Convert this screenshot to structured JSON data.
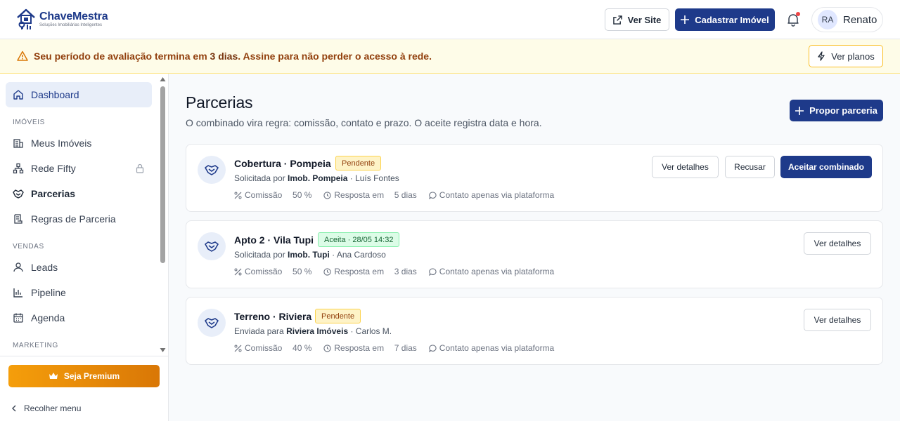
{
  "brand": {
    "name": "ChaveMestra",
    "tagline": "Soluções Imobiliárias Inteligentes"
  },
  "header": {
    "ver_site": "Ver Site",
    "cadastrar": "Cadastrar Imóvel",
    "user_initials": "RA",
    "user_name": "Renato"
  },
  "banner": {
    "text_before": "Seu período de avaliação termina em ",
    "highlight": "3 dias",
    "text_after": ". Assine para não perder o acesso à rede.",
    "button": "Ver planos"
  },
  "sidebar": {
    "dashboard": "Dashboard",
    "section_imoveis": "IMÓVEIS",
    "meus_imoveis": "Meus Imóveis",
    "rede_fifty": "Rede Fifty",
    "parcerias": "Parcerias",
    "regras": "Regras de Parceria",
    "section_vendas": "VENDAS",
    "leads": "Leads",
    "pipeline": "Pipeline",
    "agenda": "Agenda",
    "section_marketing": "MARKETING",
    "premium": "Seja Premium",
    "collapse": "Recolher menu"
  },
  "page": {
    "title": "Parcerias",
    "subtitle": "O combinado vira regra: comissão, contato e prazo. O aceite registra data e hora.",
    "propor": "Propor parceria"
  },
  "labels": {
    "comissao": "Comissão",
    "resposta": "Resposta em",
    "contato": "Contato apenas via plataforma",
    "ver_detalhes": "Ver detalhes",
    "recusar": "Recusar",
    "aceitar": "Aceitar combinado"
  },
  "cards": [
    {
      "title": "Cobertura · Pompeia",
      "status": "Pendente",
      "prefix": "Solicitada por ",
      "org": "Imob. Pompeia",
      "contact": " · Luís Fontes",
      "comissao": "50 %",
      "resposta": "5 dias"
    },
    {
      "title": "Apto 2 · Vila Tupi",
      "status": "Aceita · 28/05 14:32",
      "prefix": "Solicitada por ",
      "org": "Imob. Tupi",
      "contact": " · Ana Cardoso",
      "comissao": "50 %",
      "resposta": "3 dias"
    },
    {
      "title": "Terreno · Riviera",
      "status": "Pendente",
      "prefix": "Enviada para ",
      "org": "Riviera Imóveis",
      "contact": " · Carlos M.",
      "comissao": "40 %",
      "resposta": "7 dias"
    }
  ]
}
